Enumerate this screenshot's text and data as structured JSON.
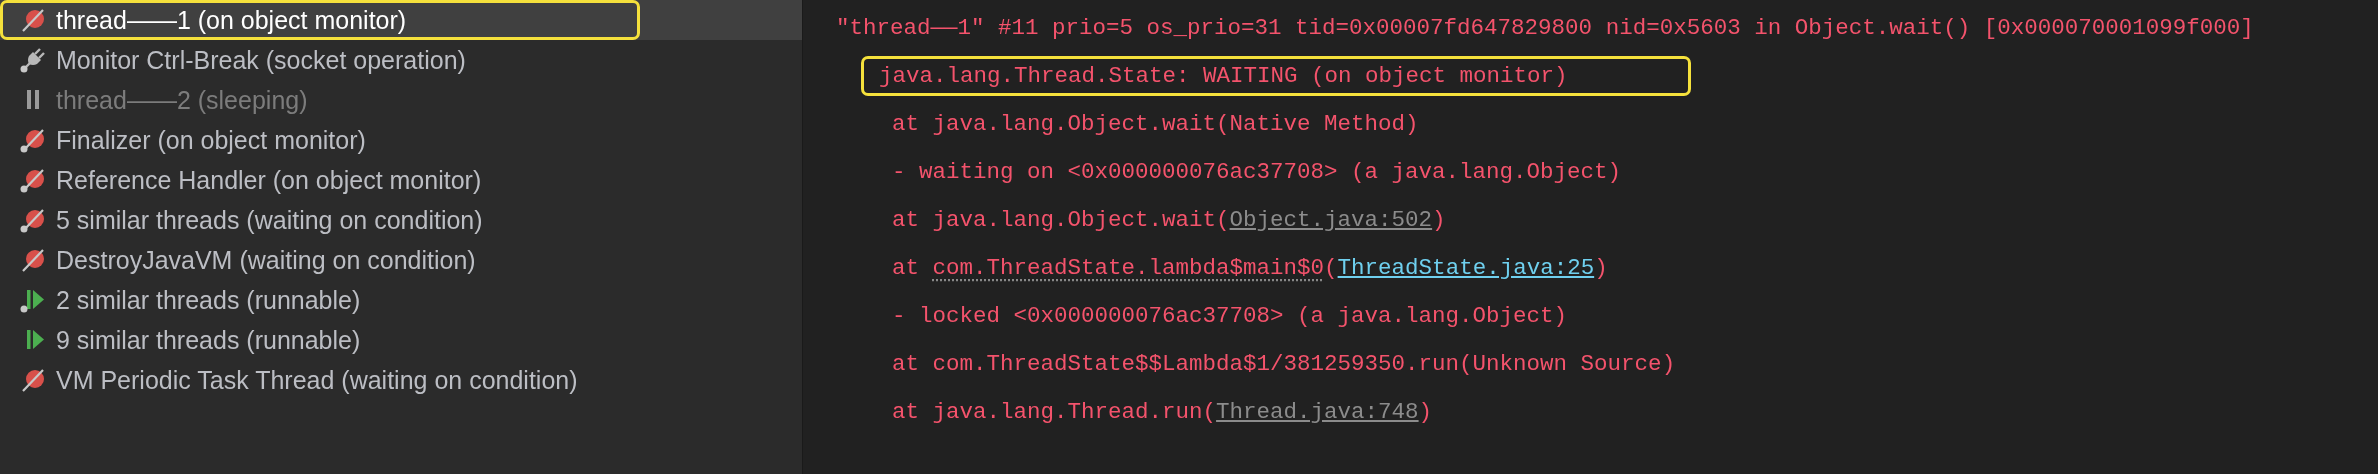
{
  "threads": [
    {
      "label": "thread——1 (on object monitor)",
      "kind": "monitor",
      "daemon": false,
      "selected": true,
      "highlighted": true,
      "dimmed": false
    },
    {
      "label": "Monitor Ctrl-Break (socket operation)",
      "kind": "socket",
      "daemon": true,
      "selected": false,
      "highlighted": false,
      "dimmed": false
    },
    {
      "label": "thread——2 (sleeping)",
      "kind": "sleeping",
      "daemon": false,
      "selected": false,
      "highlighted": false,
      "dimmed": true
    },
    {
      "label": "Finalizer (on object monitor)",
      "kind": "monitor",
      "daemon": true,
      "selected": false,
      "highlighted": false,
      "dimmed": false
    },
    {
      "label": "Reference Handler (on object monitor)",
      "kind": "monitor",
      "daemon": true,
      "selected": false,
      "highlighted": false,
      "dimmed": false
    },
    {
      "label": "5 similar threads (waiting on condition)",
      "kind": "monitor",
      "daemon": true,
      "selected": false,
      "highlighted": false,
      "dimmed": false
    },
    {
      "label": "DestroyJavaVM (waiting on condition)",
      "kind": "monitor",
      "daemon": false,
      "selected": false,
      "highlighted": false,
      "dimmed": false
    },
    {
      "label": "2 similar threads (runnable)",
      "kind": "runnable",
      "daemon": true,
      "selected": false,
      "highlighted": false,
      "dimmed": false
    },
    {
      "label": "9 similar threads (runnable)",
      "kind": "runnable",
      "daemon": false,
      "selected": false,
      "highlighted": false,
      "dimmed": false
    },
    {
      "label": "VM Periodic Task Thread (waiting on condition)",
      "kind": "monitor",
      "daemon": false,
      "selected": false,
      "highlighted": false,
      "dimmed": false
    }
  ],
  "stack_trace": [
    {
      "kind": "header",
      "highlighted": false,
      "parts": [
        {
          "text": "\"thread——1\" #11 prio=5 os_prio=31 tid=0x00007fd647829800 nid=0x5603 in Object.wait() [0x000070001099f000]"
        }
      ]
    },
    {
      "kind": "state",
      "highlighted": true,
      "parts": [
        {
          "text": "java.lang.Thread.State: WAITING (on object monitor)"
        }
      ]
    },
    {
      "kind": "frame",
      "highlighted": false,
      "parts": [
        {
          "text": "at java.lang.Object.wait(Native Method)"
        }
      ]
    },
    {
      "kind": "frame",
      "highlighted": false,
      "parts": [
        {
          "text": "- waiting on <0x000000076ac37708> (a java.lang.Object)"
        }
      ]
    },
    {
      "kind": "frame",
      "highlighted": false,
      "parts": [
        {
          "text": "at java.lang.Object.wait("
        },
        {
          "text": "Object.java:502",
          "kind": "library-link"
        },
        {
          "text": ")"
        }
      ]
    },
    {
      "kind": "frame",
      "highlighted": false,
      "parts": [
        {
          "text": "at "
        },
        {
          "text": "com.ThreadState.lambda$main$0",
          "kind": "dotted"
        },
        {
          "text": "("
        },
        {
          "text": "ThreadState.java:25",
          "kind": "source-link"
        },
        {
          "text": ")"
        }
      ]
    },
    {
      "kind": "frame",
      "highlighted": false,
      "parts": [
        {
          "text": "- locked <0x000000076ac37708> (a java.lang.Object)"
        }
      ]
    },
    {
      "kind": "frame",
      "highlighted": false,
      "parts": [
        {
          "text": "at com.ThreadState$$Lambda$1/381259350.run(Unknown Source)"
        }
      ]
    },
    {
      "kind": "frame",
      "highlighted": false,
      "parts": [
        {
          "text": "at java.lang.Thread.run("
        },
        {
          "text": "Thread.java:748",
          "kind": "library-link"
        },
        {
          "text": ")"
        }
      ]
    }
  ]
}
